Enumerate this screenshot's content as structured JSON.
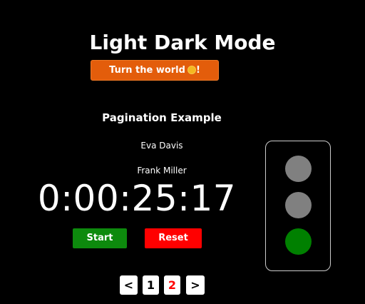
{
  "header": {
    "title": "Light Dark Mode",
    "toggle_label": "Turn the world",
    "toggle_suffix": "!",
    "toggle_icon": "sun-icon",
    "toggle_color": "#e35d0b"
  },
  "pagination": {
    "title": "Pagination Example",
    "items": [
      "Eva Davis",
      "Frank Miller"
    ],
    "prev_label": "<",
    "next_label": ">",
    "pages": [
      "1",
      "2"
    ],
    "current_page": "2",
    "current_color": "#ff0000"
  },
  "stopwatch": {
    "time": "0:00:25:17",
    "start_label": "Start",
    "reset_label": "Reset",
    "start_color": "#0d8a0d",
    "reset_color": "#ff0000"
  },
  "traffic_light": {
    "active": "green",
    "lamps": [
      {
        "name": "red",
        "color": "#808080"
      },
      {
        "name": "yellow",
        "color": "#808080"
      },
      {
        "name": "green",
        "color": "#008000"
      }
    ]
  }
}
